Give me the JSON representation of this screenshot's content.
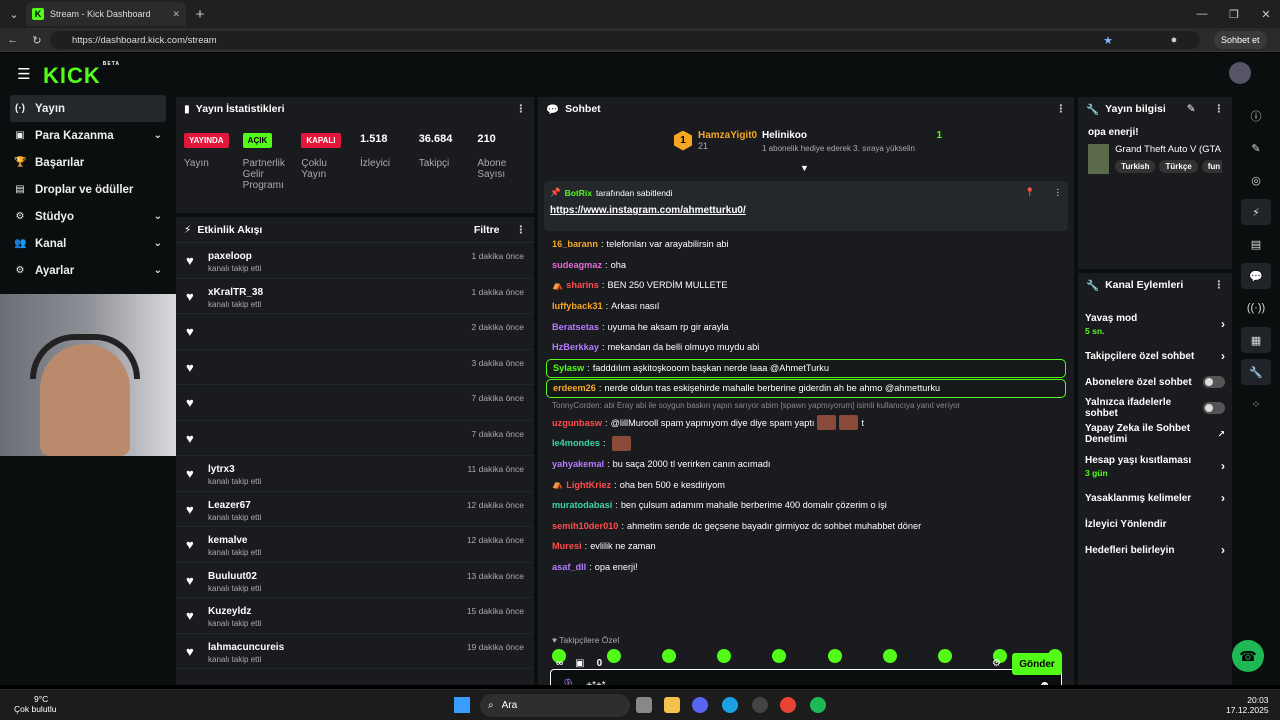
{
  "browser": {
    "tab_title": "Stream - Kick Dashboard",
    "url": "https://dashboard.kick.com/stream",
    "profile_button": "Sohbet et"
  },
  "app": {
    "logo": "KICK",
    "logo_sup": "BETA"
  },
  "sidebar": {
    "items": [
      {
        "label": "Yayın",
        "icon": "broadcast-icon"
      },
      {
        "label": "Para Kazanma",
        "icon": "money-icon",
        "chev": true
      },
      {
        "label": "Başarılar",
        "icon": "trophy-icon"
      },
      {
        "label": "Droplar ve ödüller",
        "icon": "gift-icon"
      },
      {
        "label": "Stüdyo",
        "icon": "gear-icon",
        "chev": true
      },
      {
        "label": "Kanal",
        "icon": "people-icon",
        "chev": true
      },
      {
        "label": "Ayarlar",
        "icon": "settings-icon",
        "chev": true
      }
    ]
  },
  "stats": {
    "title": "Yayın İstatistikleri",
    "items": [
      {
        "badge": "YAYINDA",
        "badge_color": "#e3173a",
        "label": "Yayın"
      },
      {
        "badge": "AÇIK",
        "badge_color": "#53fc18",
        "label": "Partnerlik Gelir Programı"
      },
      {
        "badge": "KAPALI",
        "badge_color": "#e3173a",
        "label": "Çoklu Yayın"
      },
      {
        "value": "1.518",
        "label": "İzleyici"
      },
      {
        "value": "36.684",
        "label": "Takipçi"
      },
      {
        "value": "210",
        "label": "Abone Sayısı"
      }
    ]
  },
  "activity": {
    "title": "Etkinlik Akışı",
    "filter": "Filtre",
    "items": [
      {
        "name": "paxeloop",
        "sub": "kanalı takip etti",
        "time": "1 dakika önce"
      },
      {
        "name": "xKralTR_38",
        "sub": "kanalı takip etti",
        "time": "1 dakika önce"
      },
      {
        "name": "",
        "sub": "",
        "time": "2 dakika önce"
      },
      {
        "name": "",
        "sub": "",
        "time": "3 dakika önce"
      },
      {
        "name": "",
        "sub": "",
        "time": "7 dakika önce"
      },
      {
        "name": "",
        "sub": "",
        "time": "7 dakika önce"
      },
      {
        "name": "lytrx3",
        "sub": "kanalı takip etti",
        "time": "11 dakika önce"
      },
      {
        "name": "Leazer67",
        "sub": "kanalı takip etti",
        "time": "12 dakika önce"
      },
      {
        "name": "kemalve",
        "sub": "kanalı takip etti",
        "time": "12 dakika önce"
      },
      {
        "name": "Buuluut02",
        "sub": "kanalı takip etti",
        "time": "13 dakika önce"
      },
      {
        "name": "Kuzeyldz",
        "sub": "kanalı takip etti",
        "time": "15 dakika önce"
      },
      {
        "name": "lahmacuncureis",
        "sub": "kanalı takip etti",
        "time": "19 dakika önce"
      }
    ]
  },
  "chat": {
    "title": "Sohbet",
    "gifter": {
      "name": "HamzaYigit0",
      "count": "21",
      "badge": "1"
    },
    "top": {
      "name": "Helinikoo",
      "count": "1",
      "desc": "1 abonelik hediye ederek 3. sıraya yükselin"
    },
    "pinned": {
      "by": "BotRix",
      "by_suffix": "tarafından sabitlendi",
      "link": "https://www.instagram.com/ahmetturku0/"
    },
    "messages": [
      {
        "user": "16_barann",
        "color": "#f5a623",
        "text": "telefonları var arayabilirsin abi"
      },
      {
        "user": "sudeagmaz",
        "color": "#e66bd3",
        "text": "oha"
      },
      {
        "user": "sharins",
        "color": "#ff4d4d",
        "text": "BEN 250 VERDİM MULLETE",
        "icon": true
      },
      {
        "user": "luffyback31",
        "color": "#f5a623",
        "text": "Arkası nasıl"
      },
      {
        "user": "Beratsetas",
        "color": "#b57bff",
        "text": "uyuma he aksam rp gir arayla"
      },
      {
        "user": "HzBerkkay",
        "color": "#b57bff",
        "text": "mekandan da belli olmuyo muydu abi"
      },
      {
        "user": "Sylasw",
        "color": "#53fc18",
        "text": "fadddılım aşkitoşkooom başkan nerde laaa @AhmetTurku",
        "hl": true
      },
      {
        "user": "erdeem26",
        "color": "#f5a623",
        "text": "nerde oldun tras eskişehirde mahalle berberine giderdin ah be ahmo @ahmetturku",
        "hl": true
      }
    ],
    "reply": "TonnyCorden: abi Eray abi ile soygun baskın yapın sarıyor abim [spawn yapmıyorum] isimli kullanıcıya yanıt veriyor",
    "messages2": [
      {
        "user": "uzgunbasw",
        "color": "#ff4d4d",
        "text": "@lillMurooll spam yapmıyom diye diye spam yaptı",
        "emotes": 2,
        "tail": "t"
      },
      {
        "user": "le4mondes",
        "color": "#3ad6a3",
        "text": "",
        "emotes": 1
      },
      {
        "user": "yahyakemal",
        "color": "#b57bff",
        "text": "bu saça 2000 tl verirken canın acımadı"
      },
      {
        "user": "LightKriez",
        "color": "#ff4d4d",
        "text": "oha ben 500 e kesdiriyom",
        "icon": true
      },
      {
        "user": "muratodabasi",
        "color": "#3ad6a3",
        "text": "ben çulsum adamım mahalle berberime 400 domalır çözerim o işi"
      },
      {
        "user": "semih10der010",
        "color": "#ff4d4d",
        "text": "ahmetim sende dc geçsene bayadır girmiyoz dc sohbet muhabbet döner"
      },
      {
        "user": "Muresi",
        "color": "#ff4d4d",
        "text": "evlilik ne zaman"
      },
      {
        "user": "asaf_dll",
        "color": "#b57bff",
        "text": "opa enerji!"
      }
    ],
    "follower_only": "Takipçilere Özel",
    "input_value": "+*+*",
    "gift_count": "0",
    "send": "Gönder"
  },
  "info": {
    "title": "Yayın bilgisi",
    "stream_title": "opa enerji!",
    "game": "Grand Theft Auto V (GTA",
    "tags": [
      "Turkish",
      "Türkçe",
      "fun"
    ]
  },
  "actions": {
    "title": "Kanal Eylemleri",
    "items": [
      {
        "label": "Yavaş mod",
        "sub": "5 sn.",
        "type": "arrow"
      },
      {
        "label": "Takipçilere özel sohbet",
        "type": "arrow"
      },
      {
        "label": "Abonelere özel sohbet",
        "type": "toggle"
      },
      {
        "label": "Yalnızca ifadelerle sohbet",
        "type": "toggle"
      },
      {
        "label": "Yapay Zeka ile Sohbet Denetimi",
        "type": "ext"
      },
      {
        "label": "Hesap yaşı kısıtlaması",
        "sub": "3 gün",
        "type": "arrow"
      },
      {
        "label": "Yasaklanmış kelimeler",
        "type": "arrow"
      },
      {
        "label": "İzleyici Yönlendir",
        "type": "none"
      },
      {
        "label": "Hedefleri belirleyin",
        "type": "arrow"
      }
    ]
  },
  "taskbar": {
    "weather_temp": "9°C",
    "weather_desc": "Çok bulutlu",
    "search": "Ara",
    "time": "20:03",
    "date": "17.12.2025"
  }
}
